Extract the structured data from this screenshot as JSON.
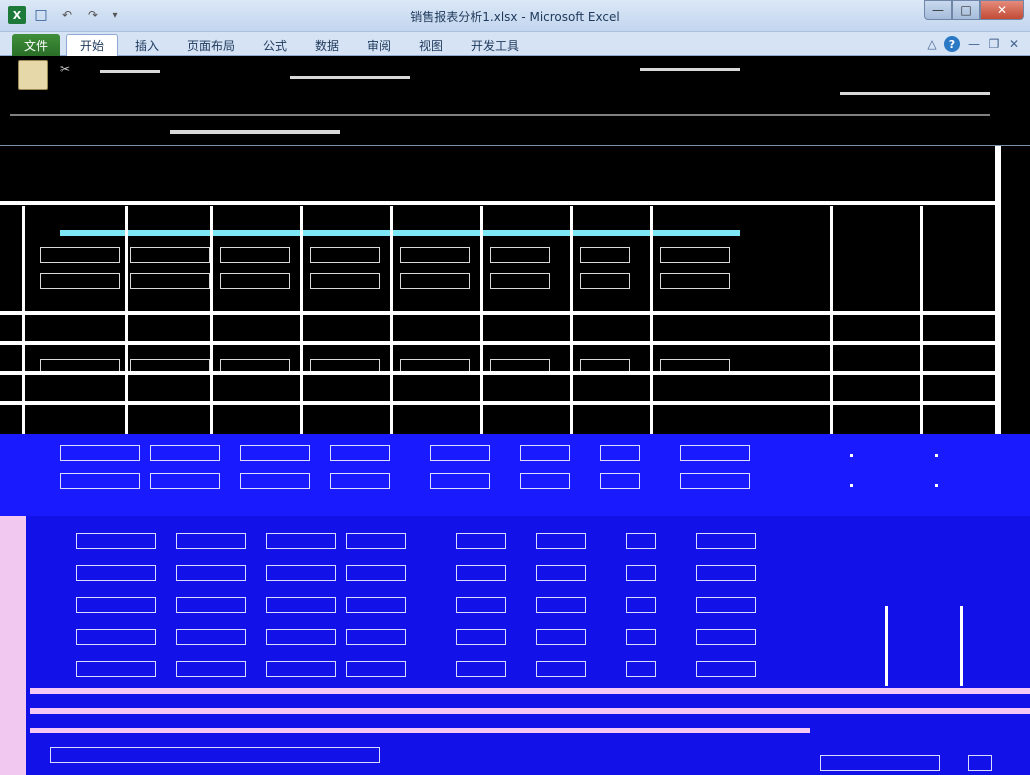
{
  "window": {
    "title": "销售报表分析1.xlsx - Microsoft Excel"
  },
  "quick_access": {
    "app_icon": "excel-icon",
    "save_icon": "save-icon",
    "undo_icon": "undo-icon",
    "redo_icon": "redo-icon",
    "customize_icon": "dropdown-icon"
  },
  "window_controls": {
    "minimize_icon": "minimize-icon",
    "maximize_icon": "maximize-icon",
    "close_icon": "close-icon"
  },
  "ribbon": {
    "tabs": [
      {
        "label": "文件"
      },
      {
        "label": "开始"
      },
      {
        "label": "插入"
      },
      {
        "label": "页面布局"
      },
      {
        "label": "公式"
      },
      {
        "label": "数据"
      },
      {
        "label": "审阅"
      },
      {
        "label": "视图"
      },
      {
        "label": "开发工具"
      }
    ],
    "active_tab": "开始",
    "right_icons": [
      "ribbon-collapse-icon",
      "help-icon",
      "doc-minimize-icon",
      "doc-restore-icon",
      "doc-close-icon"
    ]
  },
  "colors": {
    "file_tab": "#2a6f27",
    "highlight_band": "#1a1aff",
    "accent_line": "#7ee7f5"
  }
}
